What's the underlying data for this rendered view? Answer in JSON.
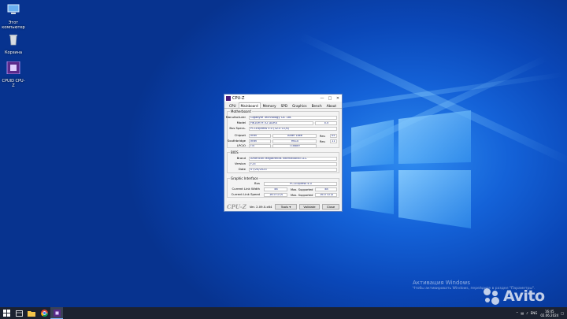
{
  "desktop": {
    "icons": [
      {
        "label": "Этот компьютер",
        "icon": "computer-icon"
      },
      {
        "label": "Корзина",
        "icon": "recycle-bin-icon"
      },
      {
        "label": "CPUID CPU-Z",
        "icon": "cpuz-icon"
      }
    ]
  },
  "window": {
    "title": "CPU-Z",
    "tabs": [
      "CPU",
      "Mainboard",
      "Memory",
      "SPD",
      "Graphics",
      "Bench",
      "About"
    ],
    "active_tab": "Mainboard",
    "motherboard": {
      "group_title": "Motherboard",
      "manufacturer_label": "Manufacturer",
      "manufacturer": "Gigabyte Technology Co. Ltd.",
      "model_label": "Model",
      "model": "H610M H V2 DDR4",
      "model_rev": "x.x",
      "bus_specs_label": "Bus Specs.",
      "bus_specs": "PCI-Express 5.0 (32.0 GT/s)",
      "chipset_label": "Chipset",
      "chipset_vendor": "Intel",
      "chipset_name": "Alder Lake",
      "chipset_rev_label": "Rev.",
      "chipset_rev": "05",
      "southbridge_label": "Southbridge",
      "southbridge_vendor": "Intel",
      "southbridge_name": "H610",
      "southbridge_rev_label": "Rev.",
      "southbridge_rev": "11",
      "lpcio_label": "LPCIO",
      "lpcio_vendor": "ITE",
      "lpcio_name": "IT8689"
    },
    "bios": {
      "group_title": "BIOS",
      "brand_label": "Brand",
      "brand": "American Megatrends International LLC.",
      "version_label": "Version",
      "version": "F25",
      "date_label": "Date",
      "date": "07/24/2023"
    },
    "graphic_interface": {
      "group_title": "Graphic Interface",
      "bus_label": "Bus",
      "bus": "PCI-Express 4.0",
      "link_width_label": "Current Link Width",
      "link_width": "x8",
      "max_supported_label": "Max. Supported",
      "max_link_width": "x8",
      "link_speed_label": "Current Link Speed",
      "link_speed": "16.0 GT/s",
      "max_speed_label": "Max. Supported",
      "max_link_speed": "16.0 GT/s"
    },
    "footer": {
      "brand": "CPU-Z",
      "version": "Ver. 2.09.0.x64",
      "tools_label": "Tools",
      "validate_label": "Validate",
      "close_label": "Close"
    }
  },
  "activation": {
    "title": "Активация Windows",
    "subtitle": "Чтобы активировать Windows, перейдите в раздел \"Параметры\"."
  },
  "watermark": "Avito",
  "taskbar": {
    "language": "ENG",
    "time": "16:45",
    "date": "02.06.2024"
  }
}
